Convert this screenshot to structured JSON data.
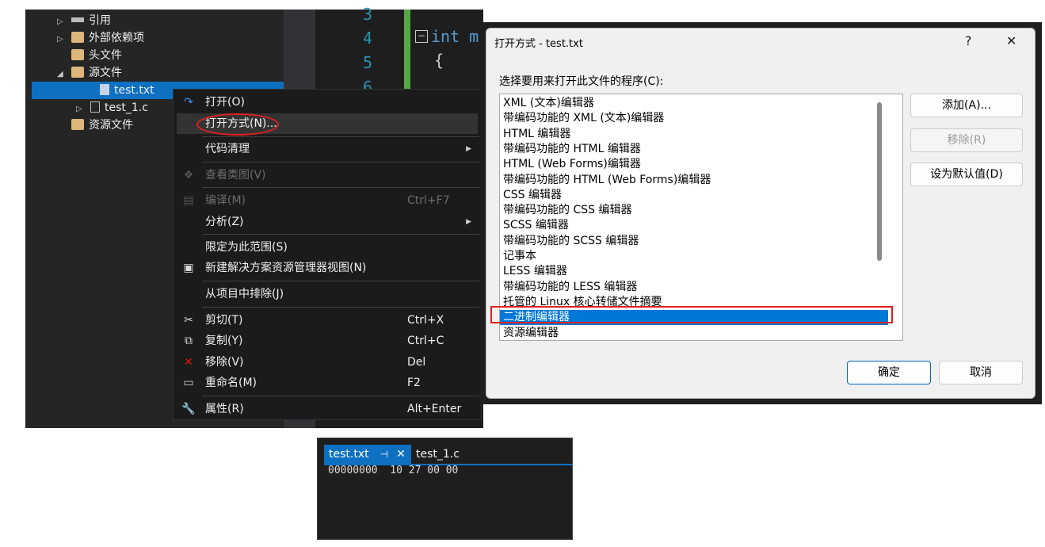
{
  "solution_explorer": {
    "items": [
      {
        "label": "引用",
        "icon": "references-icon",
        "expanded": false
      },
      {
        "label": "外部依赖项",
        "icon": "external-deps-folder-icon",
        "expanded": false
      },
      {
        "label": "头文件",
        "icon": "filter-folder-icon"
      },
      {
        "label": "源文件",
        "icon": "filter-folder-open-icon",
        "expanded": true
      },
      {
        "label": "test.txt",
        "icon": "text-file-icon",
        "selected": true
      },
      {
        "label": "test_1.c",
        "icon": "c-file-icon",
        "expanded": false
      },
      {
        "label": "资源文件",
        "icon": "filter-folder-icon"
      }
    ]
  },
  "editor": {
    "line_numbers": [
      "3",
      "4",
      "5",
      "6"
    ],
    "code_fragment": "int m",
    "brace": "{"
  },
  "context_menu": {
    "items": [
      {
        "label": "打开(O)",
        "icon": "open-icon"
      },
      {
        "label": "打开方式(N)...",
        "highlighted": true
      },
      {
        "label": "代码清理",
        "submenu": true
      },
      {
        "label": "查看类图(V)",
        "icon": "class-diagram-icon",
        "disabled": true
      },
      {
        "label": "编译(M)",
        "shortcut": "Ctrl+F7",
        "icon": "compile-icon",
        "disabled": true
      },
      {
        "label": "分析(Z)",
        "submenu": true
      },
      {
        "label": "限定为此范围(S)"
      },
      {
        "label": "新建解决方案资源管理器视图(N)",
        "icon": "new-view-icon"
      },
      {
        "label": "从项目中排除(J)"
      },
      {
        "label": "剪切(T)",
        "shortcut": "Ctrl+X",
        "icon": "cut-icon"
      },
      {
        "label": "复制(Y)",
        "shortcut": "Ctrl+C",
        "icon": "copy-icon"
      },
      {
        "label": "移除(V)",
        "shortcut": "Del",
        "icon": "remove-icon"
      },
      {
        "label": "重命名(M)",
        "shortcut": "F2",
        "icon": "rename-icon"
      },
      {
        "label": "属性(R)",
        "shortcut": "Alt+Enter",
        "icon": "wrench-icon"
      }
    ]
  },
  "dialog": {
    "title": "打开方式 - test.txt",
    "help": "?",
    "close": "✕",
    "prompt": "选择要用来打开此文件的程序(C):",
    "programs": [
      "XML (文本)编辑器",
      "带编码功能的 XML (文本)编辑器",
      "HTML 编辑器",
      "带编码功能的 HTML 编辑器",
      "HTML (Web Forms)编辑器",
      "带编码功能的 HTML (Web Forms)编辑器",
      "CSS 编辑器",
      "带编码功能的 CSS 编辑器",
      "SCSS 编辑器",
      "带编码功能的 SCSS 编辑器",
      "记事本",
      "LESS 编辑器",
      "带编码功能的 LESS 编辑器",
      "托管的 Linux 核心转储文件摘要",
      "二进制编辑器",
      "资源编辑器"
    ],
    "selected_program": "二进制编辑器",
    "add_button": "添加(A)...",
    "remove_button": "移除(R)",
    "set_default_button": "设为默认值(D)",
    "ok_button": "确定",
    "cancel_button": "取消"
  },
  "hex_view": {
    "tabs": [
      {
        "label": "test.txt",
        "active": true,
        "pin": "⊣",
        "close": "✕"
      },
      {
        "label": "test_1.c"
      }
    ],
    "row": {
      "offset": "00000000",
      "bytes": [
        "10",
        "27",
        "00",
        "00"
      ]
    }
  },
  "accent": "#0e70c0",
  "highlight_ring": "#e02020"
}
